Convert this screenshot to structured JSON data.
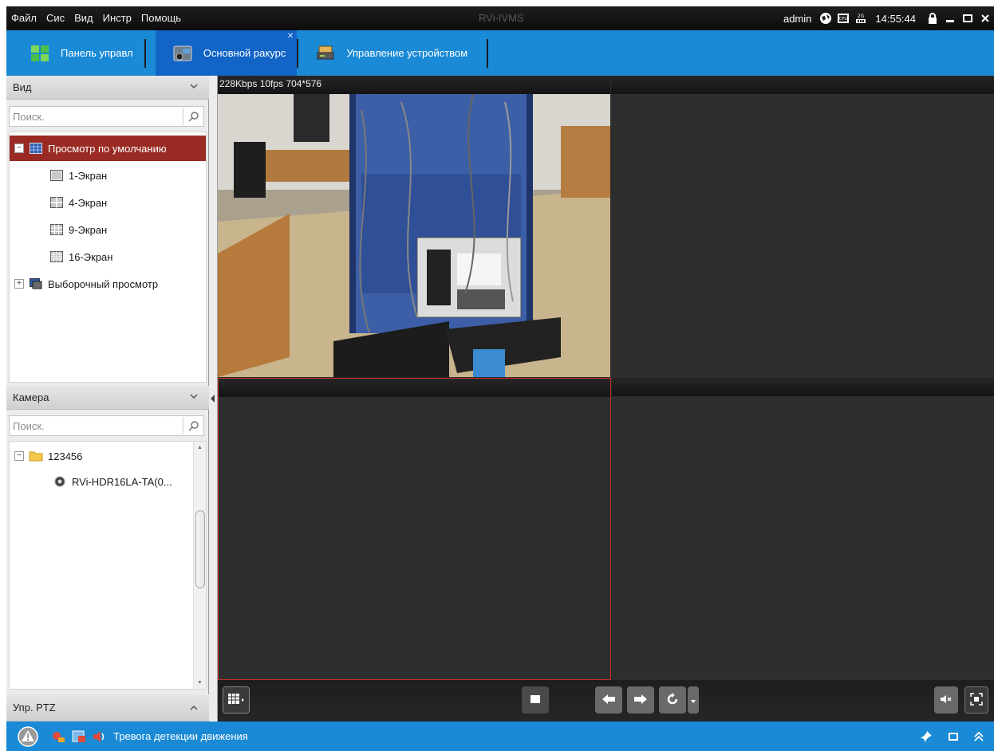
{
  "app": {
    "title": "RVi-IVMS"
  },
  "menu": [
    "Файл",
    "Сис",
    "Вид",
    "Инстр",
    "Помощь"
  ],
  "system": {
    "user": "admin",
    "time": "14:55:44",
    "cpu_label": "CPU",
    "mem_label": "2G"
  },
  "tabs": [
    {
      "label": "Панель управл",
      "icon": "grid-icon"
    },
    {
      "label": "Основной ракурс",
      "icon": "camera-view-icon",
      "active": true
    },
    {
      "label": "Управление устройством",
      "icon": "device-icon"
    }
  ],
  "view_panel": {
    "title": "Вид",
    "search_placeholder": "Поиск.",
    "items": [
      {
        "label": "Просмотр по умолчанию",
        "expander": "−",
        "selected": true
      },
      {
        "label": "1-Экран"
      },
      {
        "label": "4-Экран"
      },
      {
        "label": "9-Экран"
      },
      {
        "label": "16-Экран"
      },
      {
        "label": "Выборочный просмотр",
        "expander": "+"
      }
    ]
  },
  "camera_panel": {
    "title": "Камера",
    "search_placeholder": "Поиск.",
    "items": [
      {
        "label": "123456",
        "expander": "−"
      },
      {
        "label": "RVi-HDR16LA-TA(0..."
      }
    ]
  },
  "ptz_panel": {
    "title": "Упр. PTZ"
  },
  "video": {
    "pane1_info": "228Kbps 10fps 704*576"
  },
  "status": {
    "alarm_text": "Тревога детекции движения"
  },
  "colors": {
    "accent_blue": "#1a8ad6",
    "active_tab": "#1264c7",
    "selected_row": "#9a2b24",
    "selected_pane_border": "#c9302c"
  }
}
